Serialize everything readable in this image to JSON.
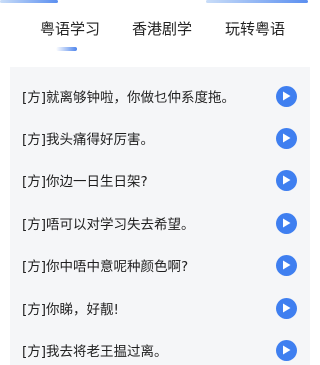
{
  "tabs": [
    {
      "label": "粤语学习",
      "active": true
    },
    {
      "label": "香港剧学",
      "active": false
    },
    {
      "label": "玩转粤语",
      "active": false
    }
  ],
  "colors": {
    "accent": "#3f7ff0",
    "panel_bg": "#f5f6f8"
  },
  "phrases": [
    {
      "text": "[方]就离够钟啦，你做乜仲系度拖。",
      "icon": "play-icon"
    },
    {
      "text": "[方]我头痛得好厉害。",
      "icon": "play-icon"
    },
    {
      "text": "[方]你边一日生日架?",
      "icon": "play-icon"
    },
    {
      "text": "[方]唔可以对学习失去希望。",
      "icon": "play-icon"
    },
    {
      "text": "[方]你中唔中意呢种颜色啊?",
      "icon": "play-icon"
    },
    {
      "text": "[方]你睇，好靓!",
      "icon": "play-icon"
    },
    {
      "text": "[方]我去将老王揾过离。",
      "icon": "play-icon"
    }
  ]
}
